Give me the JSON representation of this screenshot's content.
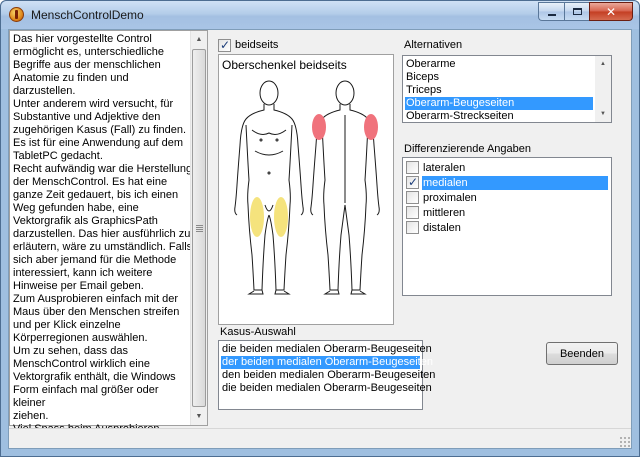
{
  "window": {
    "title": "MenschControlDemo",
    "min_label": "",
    "max_label": "",
    "close_label": "✕"
  },
  "info": {
    "text": "Das hier vorgestellte Control\nermöglicht es, unterschiedliche\nBegriffe aus der menschlichen\nAnatomie zu finden und darzustellen.\nUnter anderem wird versucht, für\nSubstantive und Adjektive den\nzugehörigen Kasus (Fall) zu finden.\nEs ist für eine Anwendung auf dem\nTabletPC gedacht.\nRecht aufwändig war die Herstellung\nder MenschControl. Es hat eine\nganze Zeit gedauert, bis ich einen\nWeg gefunden habe, eine\nVektorgrafik als GraphicsPath\ndarzustellen. Das hier ausführlich zu\nerläutern, wäre zu umständlich. Falls\nsich aber jemand für die Methode\ninteressiert, kann ich weitere\nHinweise per Email geben.\nZum Ausprobieren einfach mit der\nMaus über den Menschen streifen\nund per Klick einzelne\nKörperregionen auswählen.\nUm zu sehen, dass das\nMenschControl wirklich eine\nVektorgrafik enthält, die Windows\nForm einfach mal größer oder kleiner\nziehen.\nViel Spass beim Ausprobieren."
  },
  "beidseits": {
    "label": "beidseits",
    "checked": true
  },
  "figure": {
    "caption": "Oberschenkel beidseits",
    "front_highlight": "#f5e37d",
    "back_highlight": "#f0727c"
  },
  "alternativen": {
    "label": "Alternativen",
    "items": [
      "Oberarme",
      "Biceps",
      "Triceps",
      "Oberarm-Beugeseiten",
      "Oberarm-Streckseiten"
    ],
    "selected_index": 3
  },
  "differenzierende": {
    "label": "Differenzierende Angaben",
    "items": [
      {
        "label": "lateralen",
        "checked": false
      },
      {
        "label": "medialen",
        "checked": true
      },
      {
        "label": "proximalen",
        "checked": false
      },
      {
        "label": "mittleren",
        "checked": false
      },
      {
        "label": "distalen",
        "checked": false
      }
    ],
    "selected_index": 1
  },
  "kasus": {
    "label": "Kasus-Auswahl",
    "items": [
      "die beiden medialen Oberarm-Beugeseiten",
      "der beiden medialen Oberarm-Beugeseiten",
      "den beiden medialen Oberarm-Beugeseiten",
      "die beiden medialen Oberarm-Beugeseiten"
    ],
    "selected_index": 1
  },
  "buttons": {
    "beenden": "Beenden"
  },
  "colors": {
    "selection": "#3399ff",
    "window_frame": "#9fbfe0"
  }
}
